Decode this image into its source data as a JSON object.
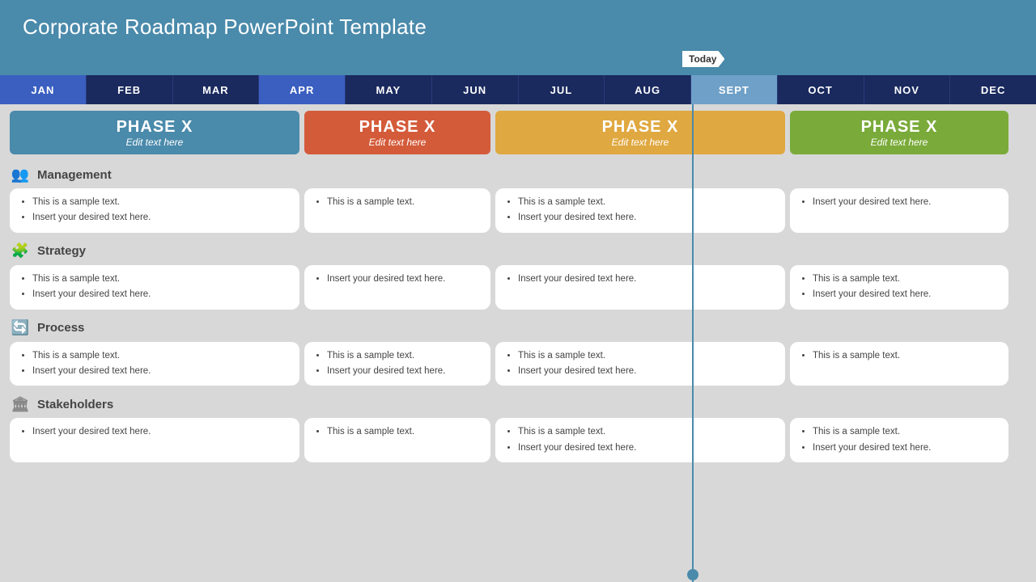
{
  "title": "Corporate Roadmap PowerPoint Template",
  "today_label": "Today",
  "months": [
    {
      "label": "JAN",
      "active": true
    },
    {
      "label": "FEB",
      "active": false
    },
    {
      "label": "MAR",
      "active": false
    },
    {
      "label": "APR",
      "active": true
    },
    {
      "label": "MAY",
      "active": false
    },
    {
      "label": "JUN",
      "active": false
    },
    {
      "label": "JUL",
      "active": false
    },
    {
      "label": "AUG",
      "active": false
    },
    {
      "label": "SEPT",
      "active": false,
      "highlight": true
    },
    {
      "label": "OCT",
      "active": false
    },
    {
      "label": "NOV",
      "active": false
    },
    {
      "label": "DEC",
      "active": false
    }
  ],
  "phases": [
    {
      "title": "PHASE X",
      "sub": "Edit text here",
      "color": "#4a8aab"
    },
    {
      "title": "PHASE X",
      "sub": "Edit text here",
      "color": "#d45b3a"
    },
    {
      "title": "PHASE X",
      "sub": "Edit text here",
      "color": "#e0a840"
    },
    {
      "title": "PHASE X",
      "sub": "Edit text here",
      "color": "#7aab3a"
    }
  ],
  "sections": [
    {
      "name": "Management",
      "icon": "👥",
      "cards": [
        [
          "This is a sample text.",
          "Insert your desired text here."
        ],
        [
          "This is a sample text."
        ],
        [
          "This is a sample text.",
          "Insert your desired text here."
        ],
        [
          "Insert your desired text here."
        ]
      ]
    },
    {
      "name": "Strategy",
      "icon": "🧩",
      "cards": [
        [
          "This is a sample text.",
          "Insert your desired text here."
        ],
        [
          "Insert your desired text here."
        ],
        [
          "Insert your desired text here."
        ],
        [
          "This is a sample text.",
          "Insert your desired text here."
        ]
      ]
    },
    {
      "name": "Process",
      "icon": "🔄",
      "cards": [
        [
          "This is a sample text.",
          "Insert your desired text here."
        ],
        [
          "This is a sample text.",
          "Insert your desired text here."
        ],
        [
          "This is a sample text.",
          "Insert your desired text here."
        ],
        [
          "This is a sample text."
        ]
      ]
    },
    {
      "name": "Stakeholders",
      "icon": "🏛",
      "cards": [
        [
          "Insert your desired text here."
        ],
        [
          "This is a sample text."
        ],
        [
          "This is a sample text.",
          "Insert your desired text here."
        ],
        [
          "This is a sample text.",
          "Insert your desired text here."
        ]
      ]
    }
  ]
}
